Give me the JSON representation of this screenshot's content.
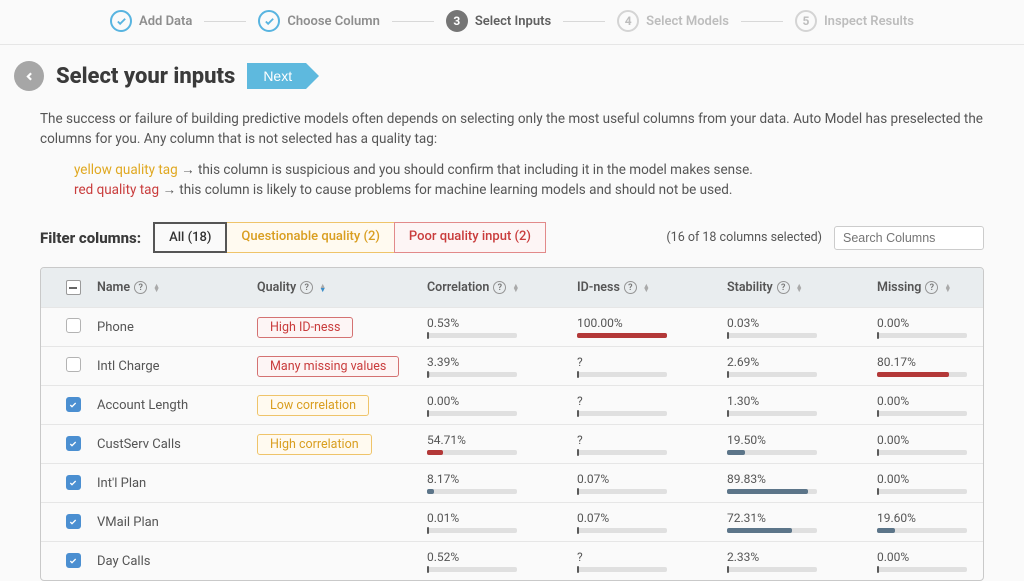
{
  "stepper": [
    {
      "label": "Add Data",
      "state": "done"
    },
    {
      "label": "Choose Column",
      "state": "done"
    },
    {
      "label": "Select Inputs",
      "state": "active",
      "num": "3"
    },
    {
      "label": "Select Models",
      "state": "todo",
      "num": "4"
    },
    {
      "label": "Inspect Results",
      "state": "todo",
      "num": "5"
    }
  ],
  "title": "Select your inputs",
  "next_label": "Next",
  "intro_main": "The success or failure of building predictive models often depends on selecting only the most useful columns from your data. Auto Model has preselected the columns for you. Any column that is not selected has a quality tag:",
  "yellow_tag": "yellow quality tag",
  "yellow_desc": " → this column is suspicious and you should confirm that including it in the model makes sense.",
  "red_tag": "red quality tag",
  "red_desc": " → this column is likely to cause problems for machine learning models and should not be used.",
  "filter_label": "Filter columns:",
  "tabs": {
    "all": "All (18)",
    "questionable": "Questionable quality (2)",
    "poor": "Poor quality input (2)"
  },
  "selected_text": "(16 of 18 columns selected)",
  "search_placeholder": "Search Columns",
  "headers": {
    "name": "Name",
    "quality": "Quality",
    "corr": "Correlation",
    "idness": "ID-ness",
    "stab": "Stability",
    "miss": "Missing"
  },
  "rows": [
    {
      "checked": false,
      "name": "Phone",
      "quality": "High ID-ness",
      "qcolor": "red",
      "corr": {
        "t": "0.53%",
        "v": 0.53,
        "c": "grey",
        "cap": true
      },
      "id": {
        "t": "100.00%",
        "v": 100,
        "c": "red"
      },
      "stab": {
        "t": "0.03%",
        "v": 0.03,
        "c": "grey",
        "cap": true
      },
      "miss": {
        "t": "0.00%",
        "v": 0,
        "c": "grey",
        "cap": true
      }
    },
    {
      "checked": false,
      "name": "Intl Charge",
      "quality": "Many missing values",
      "qcolor": "red",
      "corr": {
        "t": "3.39%",
        "v": 3.39,
        "c": "grey",
        "cap": true
      },
      "id": {
        "t": "?",
        "v": 0,
        "c": "grey",
        "cap": true
      },
      "stab": {
        "t": "2.69%",
        "v": 2.69,
        "c": "grey",
        "cap": true
      },
      "miss": {
        "t": "80.17%",
        "v": 80.17,
        "c": "red"
      }
    },
    {
      "checked": true,
      "name": "Account Length",
      "quality": "Low correlation",
      "qcolor": "yellow",
      "corr": {
        "t": "0.00%",
        "v": 0,
        "c": "grey",
        "cap": true
      },
      "id": {
        "t": "?",
        "v": 0,
        "c": "grey",
        "cap": true
      },
      "stab": {
        "t": "1.30%",
        "v": 1.3,
        "c": "grey",
        "cap": true
      },
      "miss": {
        "t": "0.00%",
        "v": 0,
        "c": "grey",
        "cap": true
      }
    },
    {
      "checked": true,
      "name": "CustServ Calls",
      "quality": "High correlation",
      "qcolor": "yellow",
      "corr": {
        "t": "54.71%",
        "v": 18,
        "c": "red"
      },
      "id": {
        "t": "?",
        "v": 0,
        "c": "grey",
        "cap": true
      },
      "stab": {
        "t": "19.50%",
        "v": 19.5,
        "c": "blue"
      },
      "miss": {
        "t": "0.00%",
        "v": 0,
        "c": "grey",
        "cap": true
      }
    },
    {
      "checked": true,
      "name": "Int'l Plan",
      "quality": "",
      "qcolor": "",
      "corr": {
        "t": "8.17%",
        "v": 8.17,
        "c": "blue"
      },
      "id": {
        "t": "0.07%",
        "v": 0.07,
        "c": "grey",
        "cap": true
      },
      "stab": {
        "t": "89.83%",
        "v": 89.83,
        "c": "blue"
      },
      "miss": {
        "t": "0.00%",
        "v": 0,
        "c": "grey",
        "cap": true
      }
    },
    {
      "checked": true,
      "name": "VMail Plan",
      "quality": "",
      "qcolor": "",
      "corr": {
        "t": "0.01%",
        "v": 0.01,
        "c": "grey",
        "cap": true
      },
      "id": {
        "t": "0.07%",
        "v": 0.07,
        "c": "grey",
        "cap": true
      },
      "stab": {
        "t": "72.31%",
        "v": 72.31,
        "c": "blue"
      },
      "miss": {
        "t": "19.60%",
        "v": 19.6,
        "c": "blue"
      }
    },
    {
      "checked": true,
      "name": "Day Calls",
      "quality": "",
      "qcolor": "",
      "corr": {
        "t": "0.52%",
        "v": 0.52,
        "c": "grey",
        "cap": true
      },
      "id": {
        "t": "?",
        "v": 0,
        "c": "grey",
        "cap": true
      },
      "stab": {
        "t": "2.33%",
        "v": 2.33,
        "c": "grey",
        "cap": true
      },
      "miss": {
        "t": "0.00%",
        "v": 0,
        "c": "grey",
        "cap": true
      }
    }
  ]
}
